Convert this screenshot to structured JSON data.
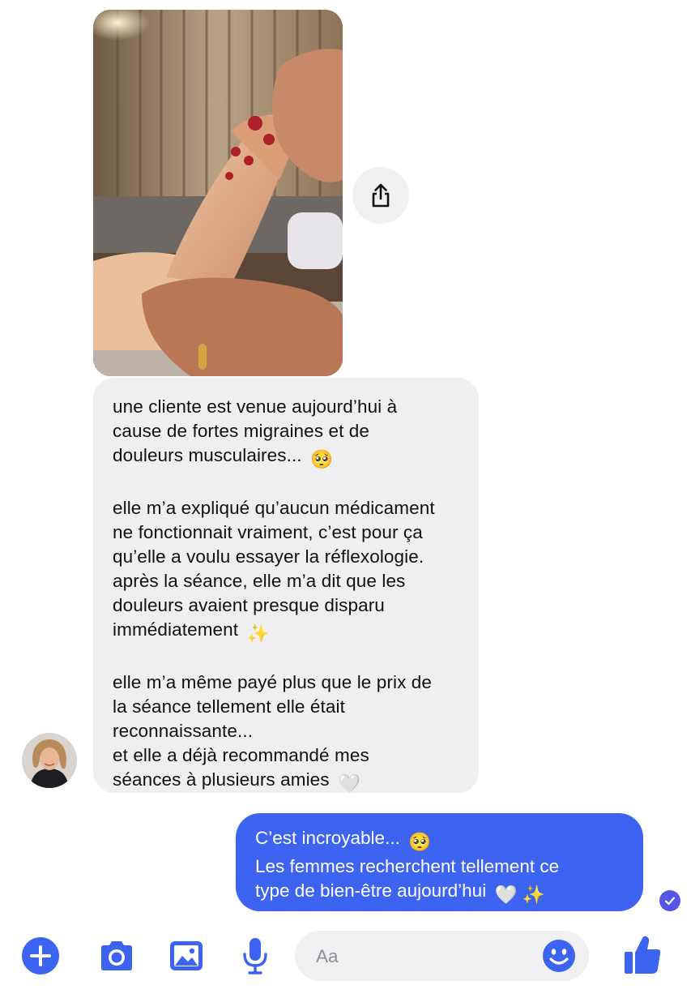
{
  "conversation": {
    "incoming_message": {
      "paragraphs": [
        {
          "lines": [
            "une cliente est venue aujourd’hui à",
            "cause de fortes migraines et de",
            "douleurs musculaires..."
          ],
          "trailing_emoji": "🥺"
        },
        {
          "lines": [
            "elle m’a expliqué qu’aucun médicament",
            "ne fonctionnait vraiment, c’est pour ça",
            "qu’elle a voulu essayer la réflexologie.",
            "après la séance, elle m’a dit que les",
            "douleurs avaient presque disparu",
            "immédiatement"
          ],
          "trailing_emoji": "✨"
        },
        {
          "lines": [
            "elle m’a même payé plus que le prix de",
            "la séance tellement elle était",
            "reconnaissante...",
            "et elle a déjà recommandé mes",
            "séances à plusieurs amies"
          ],
          "trailing_emoji": "🤍"
        }
      ]
    },
    "outgoing_message": {
      "lines": [
        "C’est incroyable...",
        "Les femmes recherchent tellement ce",
        "type de bien-être aujourd’hui"
      ],
      "line_emojis": [
        "🥺",
        "",
        "🤍 ✨"
      ]
    }
  },
  "composer": {
    "placeholder": "Aa"
  },
  "icons": {
    "share": "share-icon",
    "add": "plus-circle-icon",
    "camera": "camera-icon",
    "gallery": "image-icon",
    "mic": "microphone-icon",
    "emoji": "smiley-icon",
    "like": "thumbs-up-icon",
    "read": "read-receipt-check-icon"
  },
  "colors": {
    "accent": "#3c64f0",
    "incoming_bubble": "#efeff1",
    "read_receipt": "#5356e6"
  }
}
